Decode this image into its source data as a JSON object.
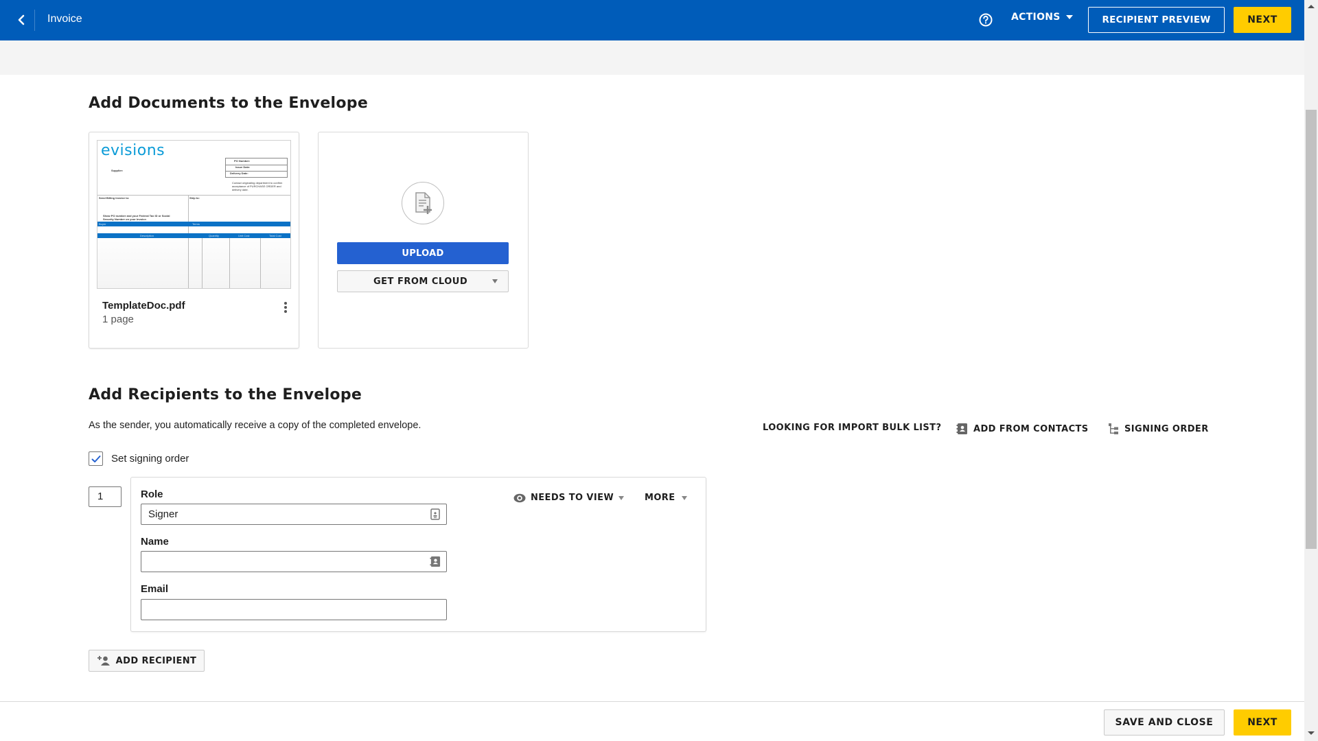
{
  "header": {
    "title": "Invoice",
    "back_icon": "chevron-left-icon",
    "help_icon": "help-circle-icon",
    "actions_label": "ACTIONS",
    "recipient_preview_label": "RECIPIENT PREVIEW",
    "next_label": "NEXT"
  },
  "documents": {
    "title": "Add Documents to the Envelope",
    "files": [
      {
        "name": "TemplateDoc.pdf",
        "pages": "1 page",
        "thumbnail": {
          "logo": "evisions",
          "supplier": "Supplier:",
          "po_number": "PO Number:",
          "issue_date": "Issue Date:",
          "delivery_date": "Delivery Date:",
          "contact_note": "Contact originating department to confirm acceptance of PURCHASE ORDER and delivery date.",
          "billing": "Send Billing Invoice to:",
          "ship_to": "Ship to:",
          "tax_note": "Show PO number and your Federal Tax ID or Social Security Number on your Invoice.",
          "buyer": "Buyer",
          "terms": "Terms",
          "col_description": "Description",
          "col_quantity": "Quantity",
          "col_unit_cost": "Unit Cost",
          "col_total_cost": "Total Cost"
        }
      }
    ],
    "upload_label": "UPLOAD",
    "cloud_label": "GET FROM CLOUD"
  },
  "recipients": {
    "title": "Add Recipients to the Envelope",
    "subtitle": "As the sender, you automatically receive a copy of the completed envelope.",
    "bulk_list_label": "LOOKING FOR IMPORT BULK LIST?",
    "add_contacts_label": "ADD FROM CONTACTS",
    "signing_order_label": "SIGNING ORDER",
    "set_signing_order_label": "Set signing order",
    "set_signing_order_checked": true,
    "list": [
      {
        "order": "1",
        "role_label": "Role",
        "role_value": "Signer",
        "name_label": "Name",
        "name_value": "",
        "email_label": "Email",
        "email_value": "",
        "action_label": "NEEDS TO VIEW",
        "more_label": "MORE"
      }
    ],
    "add_recipient_label": "ADD RECIPIENT"
  },
  "footer": {
    "save_close_label": "SAVE AND CLOSE",
    "next_label": "NEXT"
  },
  "colors": {
    "header_bg": "#005cb9",
    "accent_yellow": "#ffcc00",
    "upload_blue": "#2461d1"
  }
}
